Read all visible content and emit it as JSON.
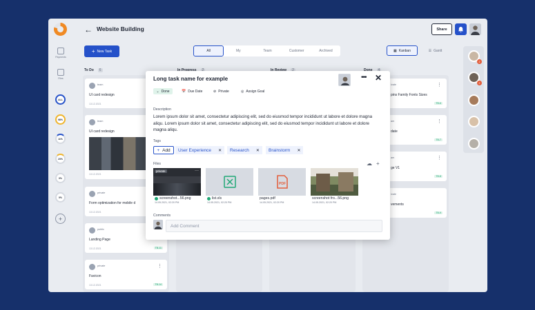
{
  "header": {
    "title": "Website Building",
    "share_label": "Share"
  },
  "sidebar": {
    "items": [
      {
        "label": "Payments",
        "icon": "wallet-icon"
      },
      {
        "label": "Files",
        "icon": "folder-icon"
      }
    ],
    "progress": [
      {
        "label": "ALL",
        "color": "#2551c9",
        "value": 100
      },
      {
        "label": "98%",
        "color": "#f0b429",
        "value": 98
      },
      {
        "label": "11%",
        "color": "#2551c9",
        "value": 11
      },
      {
        "label": "23%",
        "color": "#f0b429",
        "value": 23
      },
      {
        "label": "0%",
        "color": "#d5d9e0",
        "value": 0
      },
      {
        "label": "0%",
        "color": "#d5d9e0",
        "value": 0
      }
    ]
  },
  "toolbar": {
    "new_task_label": "New Task",
    "view_kanban": "Kanban",
    "view_gantt": "Gantt"
  },
  "tabs": [
    {
      "label": "All",
      "active": true
    },
    {
      "label": "My"
    },
    {
      "label": "Team"
    },
    {
      "label": "Customer"
    },
    {
      "label": "Archived"
    }
  ],
  "columns": [
    {
      "title": "To Do",
      "count": "6"
    },
    {
      "title": "In Progress",
      "count": "2"
    },
    {
      "title": "In Review",
      "count": "2"
    },
    {
      "title": "Done",
      "count": "4"
    }
  ],
  "todo_cards": [
    {
      "tag": "team",
      "title": "UI card redesign",
      "date": "13.12.2021",
      "id": ""
    },
    {
      "tag": "team",
      "title": "UI card redesign",
      "date": "13.12.2021",
      "id": ""
    },
    {
      "tag": "private",
      "title": "Form optimization for mobile d",
      "date": "13.12.2021",
      "id": ""
    },
    {
      "tag": "public",
      "title": "Landing Page",
      "date": "13.12.2021",
      "id": "TB-11"
    },
    {
      "tag": "private",
      "title": "Favicon",
      "date": "13.12.2021",
      "id": "TB-14"
    }
  ],
  "done_cards": [
    {
      "tag": "ivate",
      "title": "pins Family Fonts Sizes",
      "id": "TB-6"
    },
    {
      "tag": "am",
      "title": "date",
      "id": "TB-7"
    },
    {
      "tag": "am",
      "title": "ge V1",
      "id": "TB-8"
    },
    {
      "tag": "ivate",
      "title": "vements",
      "id": "TB-9"
    }
  ],
  "modal": {
    "title": "Long task name for example",
    "status": "Done",
    "due_date_label": "Due Date",
    "privacy_label": "Private",
    "assign_label": "Assign Goal",
    "description_label": "Description",
    "description": "Lorem ipsum dolor sit amet, consectetur adipiscing elit, sed do eiusmod tempor incididunt ut labore et dolore magna aliqu. Lorem ipsum dolor sit amet, consectetur adipiscing elit, sed do eiusmod tempor incididunt ut labore et dolore magna aliqu.",
    "tags_label": "Tags",
    "add_tag_label": "Add",
    "tags": [
      "User Experience",
      "Research",
      "Brainstorm"
    ],
    "files_label": "Files",
    "files": [
      {
        "name": "screenshot...56.png",
        "date": "14.05.2021, 02:20 PM",
        "badge": "private",
        "type": "image-dark"
      },
      {
        "name": "list.xls",
        "date": "14.05.2021, 02:20 PM",
        "type": "xls"
      },
      {
        "name": "pages.pdf",
        "date": "14.05.2021, 02:20 PM",
        "type": "pdf"
      },
      {
        "name": "screenshot fro...56.png",
        "date": "14.05.2021, 02:20 PM",
        "type": "image-photo"
      }
    ],
    "comments_label": "Comments",
    "comment_placeholder": "Add Comment"
  },
  "right_avatars": [
    {
      "badge": "2"
    },
    {
      "badge": "2"
    },
    {
      "badge": ""
    },
    {
      "badge": ""
    },
    {
      "badge": ""
    }
  ],
  "colors": {
    "accent": "#2551c9",
    "background": "#16306b",
    "done_green": "#1fa875"
  }
}
